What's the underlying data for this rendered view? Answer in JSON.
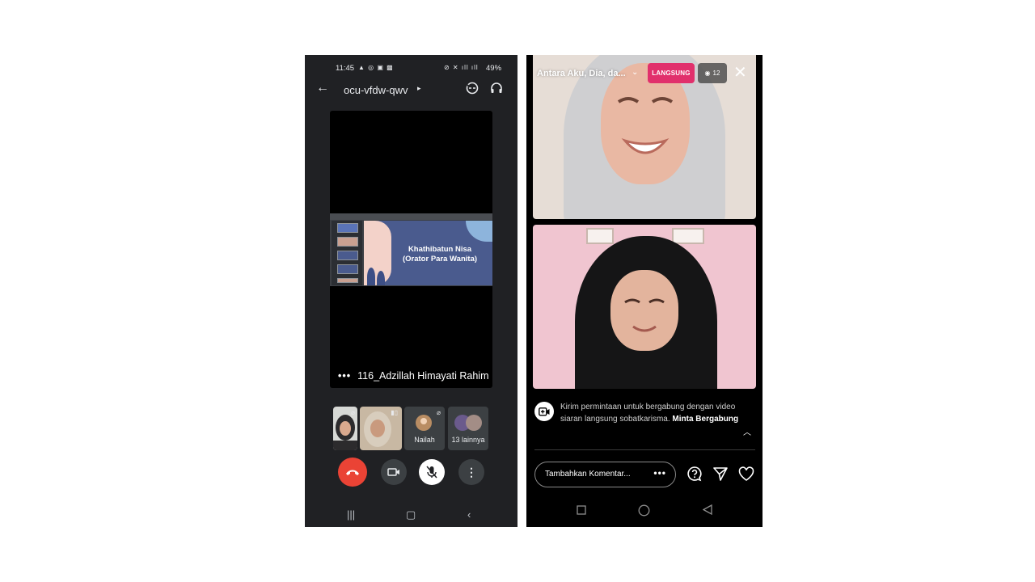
{
  "meet": {
    "status": {
      "time": "11:45",
      "battery": "49%"
    },
    "toolbar": {
      "meeting_code": "ocu-vfdw-qwv"
    },
    "presentation": {
      "slide_title_line1": "Khathibatun Nisa",
      "slide_title_line2": "(Orator Para Wanita)"
    },
    "presenter_name": "116_Adzillah Himayati Rahim",
    "participants": [
      {
        "label": "Nailah"
      },
      {
        "label": "13 lainnya"
      }
    ],
    "colors": {
      "background": "#202124",
      "end_call": "#ea4335",
      "tile": "#3c4043"
    }
  },
  "ig": {
    "title": "Antara Aku, Dia, da...",
    "live_badge": "LANGSUNG",
    "viewer_count": "12",
    "join_request": {
      "text": "Kirim permintaan untuk bergabung dengan video siaran langsung sobatkarisma.",
      "action": "Minta Bergabung"
    },
    "comment_placeholder": "Tambahkan Komentar...",
    "colors": {
      "live": "#e1306c",
      "background": "#000000"
    }
  }
}
